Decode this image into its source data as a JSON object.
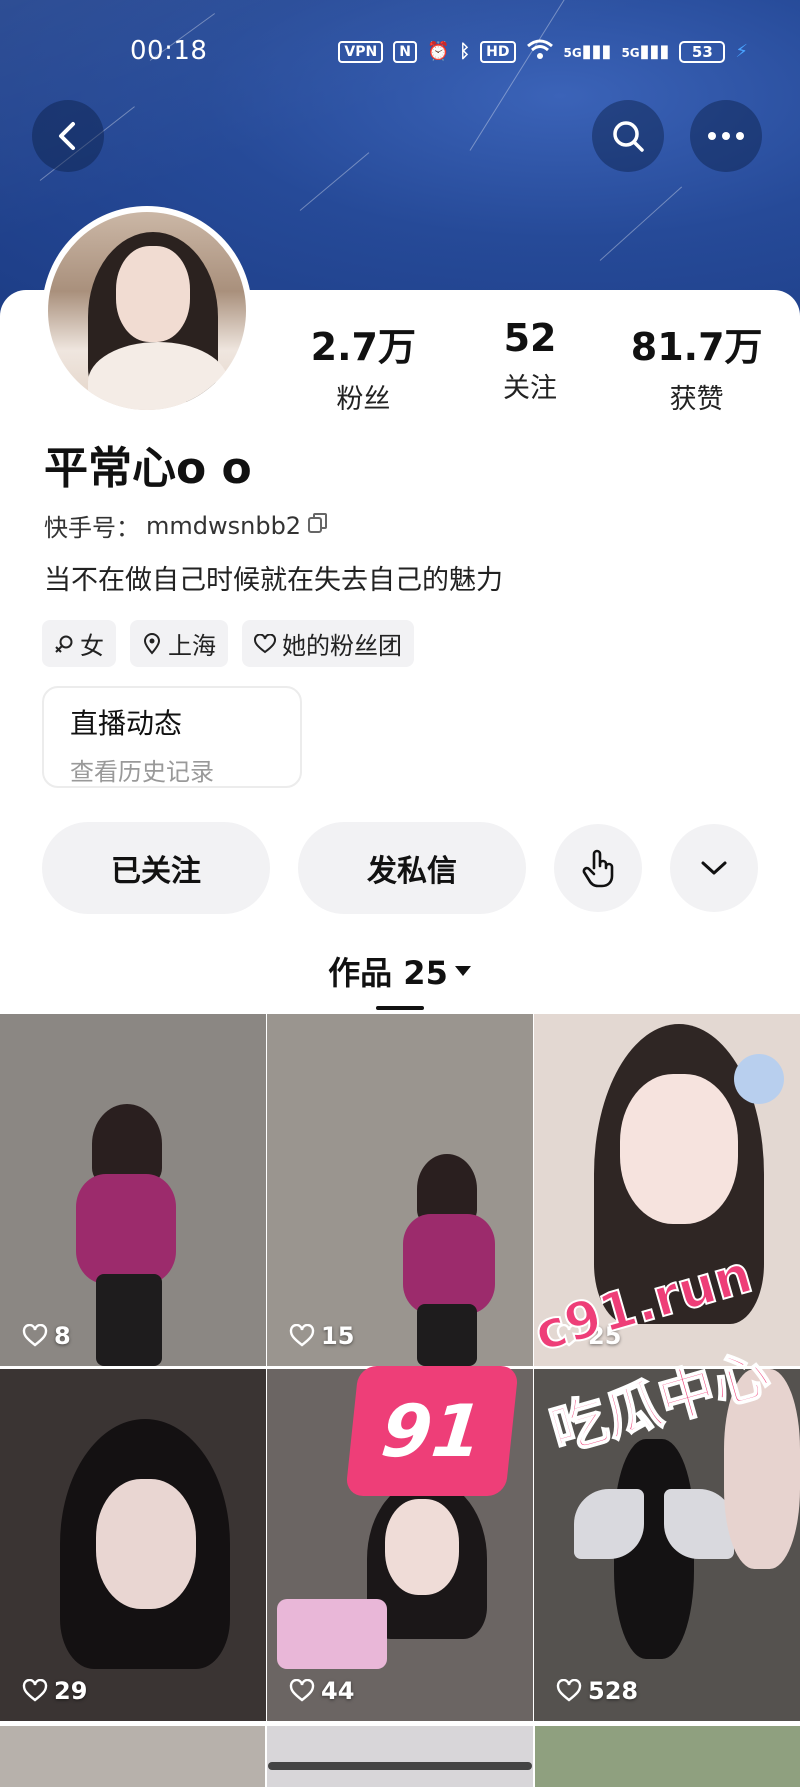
{
  "status_bar": {
    "time": "00:18",
    "vpn": "VPN",
    "nfc": "N",
    "hd": "HD",
    "net1": "5G",
    "net2": "5G",
    "battery": "53"
  },
  "header": {
    "back_icon": "chevron-left-icon",
    "search_icon": "search-icon",
    "more_icon": "more-dots-icon"
  },
  "profile": {
    "stats": [
      {
        "value": "2.7万",
        "label": "粉丝"
      },
      {
        "value": "52",
        "label": "关注"
      },
      {
        "value": "81.7万",
        "label": "获赞"
      }
    ],
    "nickname": "平常心o o",
    "kuaishou_id_label": "快手号：",
    "kuaishou_id": "mmdwsnbb2",
    "bio": "当不在做自己时候就在失去自己的魅力",
    "tags": [
      {
        "icon": "female-icon",
        "label": "女"
      },
      {
        "icon": "location-icon",
        "label": "上海"
      },
      {
        "icon": "heart-icon",
        "label": "她的粉丝团"
      }
    ]
  },
  "live_card": {
    "title": "直播动态",
    "subtitle": "查看历史记录"
  },
  "actions": {
    "follow_label": "已关注",
    "message_label": "发私信"
  },
  "tabs": {
    "works_label": "作品 25"
  },
  "works": [
    {
      "likes": "8",
      "bg": "#8b8783"
    },
    {
      "likes": "15",
      "bg": "#9a958f"
    },
    {
      "likes": "25",
      "bg": "#e3d8d2"
    },
    {
      "likes": "29",
      "bg": "#3a3433"
    },
    {
      "likes": "44",
      "bg": "#6b6563"
    },
    {
      "likes": "528",
      "bg": "#55524f"
    }
  ],
  "watermark": {
    "number": "91",
    "url": "c91.run",
    "text": "吃瓜中心"
  },
  "colors": {
    "cover_blue": "#264a98",
    "accent_pink": "#ee3e78",
    "pill_bg": "#f2f2f4"
  }
}
